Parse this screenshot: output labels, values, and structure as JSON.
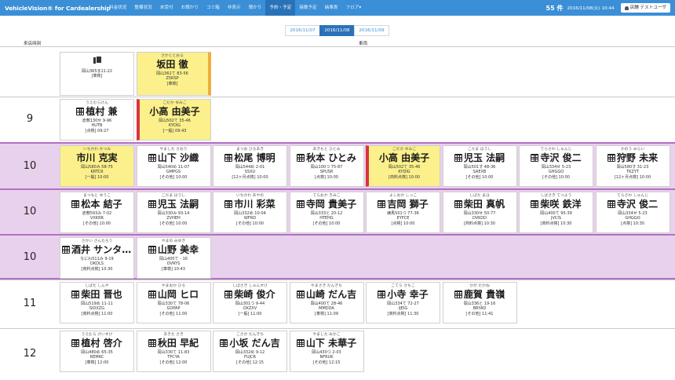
{
  "nav": {
    "brand": "VehicleVision® for Cardealership",
    "items": [
      "料金状況",
      "整備状況",
      "未受付",
      "お預かり",
      "コミ箱",
      "非表示",
      "預かり",
      "予約・予定",
      "接数予定",
      "納車表",
      "フロア▾"
    ],
    "active_index": 7,
    "count": "55 件",
    "datetime": "2016/11/08(火) 10:44",
    "user_label": "店舗 テストユーザ"
  },
  "date_tabs": [
    "2016/11/07",
    "2016/11/08",
    "2016/11/09"
  ],
  "active_date_index": 1,
  "column_headers": {
    "time": "来店時刻",
    "vehicle": "車両"
  },
  "rows": [
    {
      "time": "",
      "cards": [
        {
          "type": "doc",
          "plate": "岡山365ま11-22",
          "code": "",
          "status": "[車検]"
        },
        {
          "type": "person",
          "kana": "さかととおる",
          "name": "坂田 徹",
          "plate": "岡山361て 83-56",
          "code": "Z5RSP",
          "status": "[車検]",
          "highlight": true,
          "bar": "orange"
        }
      ]
    },
    {
      "time": "9",
      "cards": [
        {
          "type": "person",
          "kana": "うえむらけん",
          "name": "植村 兼",
          "plate": "倉敷130せ 9-96",
          "code": "HUTB",
          "status": "[点検] 09:27",
          "icon": true
        },
        {
          "type": "person",
          "kana": "こだか ゆみこ",
          "name": "小高 由美子",
          "plate": "岡山502て 35-46",
          "code": "KYDIG",
          "status": "[一般] 09:43",
          "highlight": true,
          "bar": "red"
        }
      ]
    },
    {
      "time": "10",
      "pink": true,
      "cards": [
        {
          "kana": "いちかわ かつみ",
          "name": "市川 克実",
          "plate": "岡山580み 58-75",
          "code": "KRTCR",
          "status": "[一般] 10:00",
          "highlight": true
        },
        {
          "kana": "やました さおり",
          "name": "山下 沙織",
          "plate": "岡山540め 11-07",
          "code": "GMPGS",
          "status": "[その他] 10:00",
          "icon": true
        },
        {
          "kana": "まつお ひろあき",
          "name": "松尾 博明",
          "plate": "岡山544め 2-01",
          "code": "SSXU",
          "status": "[12ヶ月点検] 10:00",
          "icon": true
        },
        {
          "kana": "あきもと ひとみ",
          "name": "秋本 ひとみ",
          "plate": "岡山100つ 75-87",
          "code": "SPUSR",
          "status": "[点検] 10:00",
          "icon": true
        },
        {
          "kana": "こだか ゆみこ",
          "name": "小高 由美子",
          "plate": "岡山502て 35-46",
          "code": "KYDIG",
          "status": "[商料点検] 10:00",
          "highlight": true,
          "bar": "red"
        },
        {
          "kana": "こだま ほうし",
          "name": "児玉 法嗣",
          "plate": "岡山501す 48-36",
          "code": "SAEXB",
          "status": "[その他] 10:00",
          "icon": true
        },
        {
          "kana": "てらさわ しゅんじ",
          "name": "寺沢 俊二",
          "plate": "岡山334せ 5-23",
          "code": "GHGGO",
          "status": "[その他] 10:00",
          "icon": true
        },
        {
          "kana": "かのう みらい",
          "name": "狩野 未来",
          "plate": "岡山580す 31-23",
          "code": "TKZYT",
          "status": "[12ヶ月点検] 10:00",
          "icon": true
        }
      ]
    },
    {
      "time": "10",
      "pink": true,
      "cards": [
        {
          "kana": "まつもと ゆうこ",
          "name": "松本 結子",
          "plate": "倉敷593み 7-02",
          "code": "VXKRR",
          "status": "[その他] 10:00",
          "icon": true
        },
        {
          "kana": "こだま ほうし",
          "name": "児玉 法嗣",
          "plate": "岡山330み 93-14",
          "code": "ZVHEH",
          "status": "[その他] 10:00",
          "icon": true
        },
        {
          "kana": "いちかわ あやの",
          "name": "市川 彩菜",
          "plate": "岡山332め 10-04",
          "code": "WFRD",
          "status": "[その他] 10:00",
          "icon": true
        },
        {
          "kana": "てらおか きみこ",
          "name": "寺岡 貴美子",
          "plate": "岡山333と 20-12",
          "code": "HTEHG",
          "status": "[その他] 10:00",
          "icon": true
        },
        {
          "kana": "よしおか しっこ",
          "name": "吉岡 獅子",
          "plate": "練馬501つ 77-36",
          "code": "EYFCE",
          "status": "[点検] 10:00",
          "icon": true
        },
        {
          "kana": "しばた まほ",
          "name": "柴田 真帆",
          "plate": "岡山330せ 50-77",
          "code": "DVKOD",
          "status": "[商料点検] 10:30",
          "icon": true
        },
        {
          "kana": "しばさき てつよう",
          "name": "柴咲 鉄洋",
          "plate": "岡山400て 95-39",
          "code": "JVCIS",
          "status": "[商料点検] 10:30",
          "icon": true
        },
        {
          "kana": "てらさわ しゅんじ",
          "name": "寺沢 俊二",
          "plate": "岡山334せ 5-23",
          "code": "GHGGO",
          "status": "[点検] 10:30",
          "icon": true
        }
      ]
    },
    {
      "time": "10",
      "pink": true,
      "lastPink": true,
      "cards": [
        {
          "kana": "さかい さんたろう",
          "name": "酒井 サンタロウ",
          "plate": "なにわ511み 9-19",
          "code": "DKDLS",
          "status": "[商料点検] 10:30",
          "icon": true
        },
        {
          "kana": "やまの みゆき",
          "name": "山野 美幸",
          "plate": "岡山400て - 16",
          "code": "OVRYS",
          "status": "[車検] 10:43",
          "icon": true
        }
      ]
    },
    {
      "time": "11",
      "cards": [
        {
          "kana": "しばた しんや",
          "name": "柴田 晋也",
          "plate": "岡山519め 11-11",
          "code": "SIDXZG",
          "status": "[商料点検] 11:00",
          "icon": true
        },
        {
          "kana": "やまおか ひろ",
          "name": "山岡 ヒロ",
          "plate": "岡山330て 78-06",
          "code": "GOPAP",
          "status": "[その他] 11:00",
          "icon": true
        },
        {
          "kana": "しばさき しゅんすけ",
          "name": "柴崎 俊介",
          "plate": "岡山301つ 9-44",
          "code": "OXZXV",
          "status": "[一般] 11:00",
          "icon": true
        },
        {
          "kana": "やまさき だんきち",
          "name": "山崎 だん吉",
          "plate": "岡山400て 28-46",
          "code": "MMDDA",
          "status": "[車検] 11:09",
          "icon": true
        },
        {
          "kana": "こてら さちこ",
          "name": "小寺 幸子",
          "plate": "岡山334て 72-27",
          "code": "IJEIG",
          "status": "[商料点検] 11:30",
          "icon": true
        },
        {
          "kana": "かが たかね",
          "name": "鹿賀 貴嶺",
          "plate": "岡山336と 19-16",
          "code": "BRYAD",
          "status": "[その他] 11:41",
          "icon": true
        }
      ]
    },
    {
      "time": "12",
      "cards": [
        {
          "kana": "うえむら けいすけ",
          "name": "植村 啓介",
          "plate": "岡山480め 65-35",
          "code": "REMKC",
          "status": "[車検] 12:00",
          "icon": true
        },
        {
          "kana": "あきた さき",
          "name": "秋田 早紀",
          "plate": "岡山330て 11-83",
          "code": "TPCYA",
          "status": "[その他] 12:00",
          "icon": true
        },
        {
          "kana": "こさか だんきち",
          "name": "小坂 だん吉",
          "plate": "岡山332め 9-12",
          "code": "FUJCR",
          "status": "[その他] 12:15",
          "icon": true
        },
        {
          "kana": "やました みかこ",
          "name": "山下 未華子",
          "plate": "岡山430つ 2-03",
          "code": "NFRUK",
          "status": "[その他] 12:15",
          "icon": true
        }
      ]
    }
  ]
}
